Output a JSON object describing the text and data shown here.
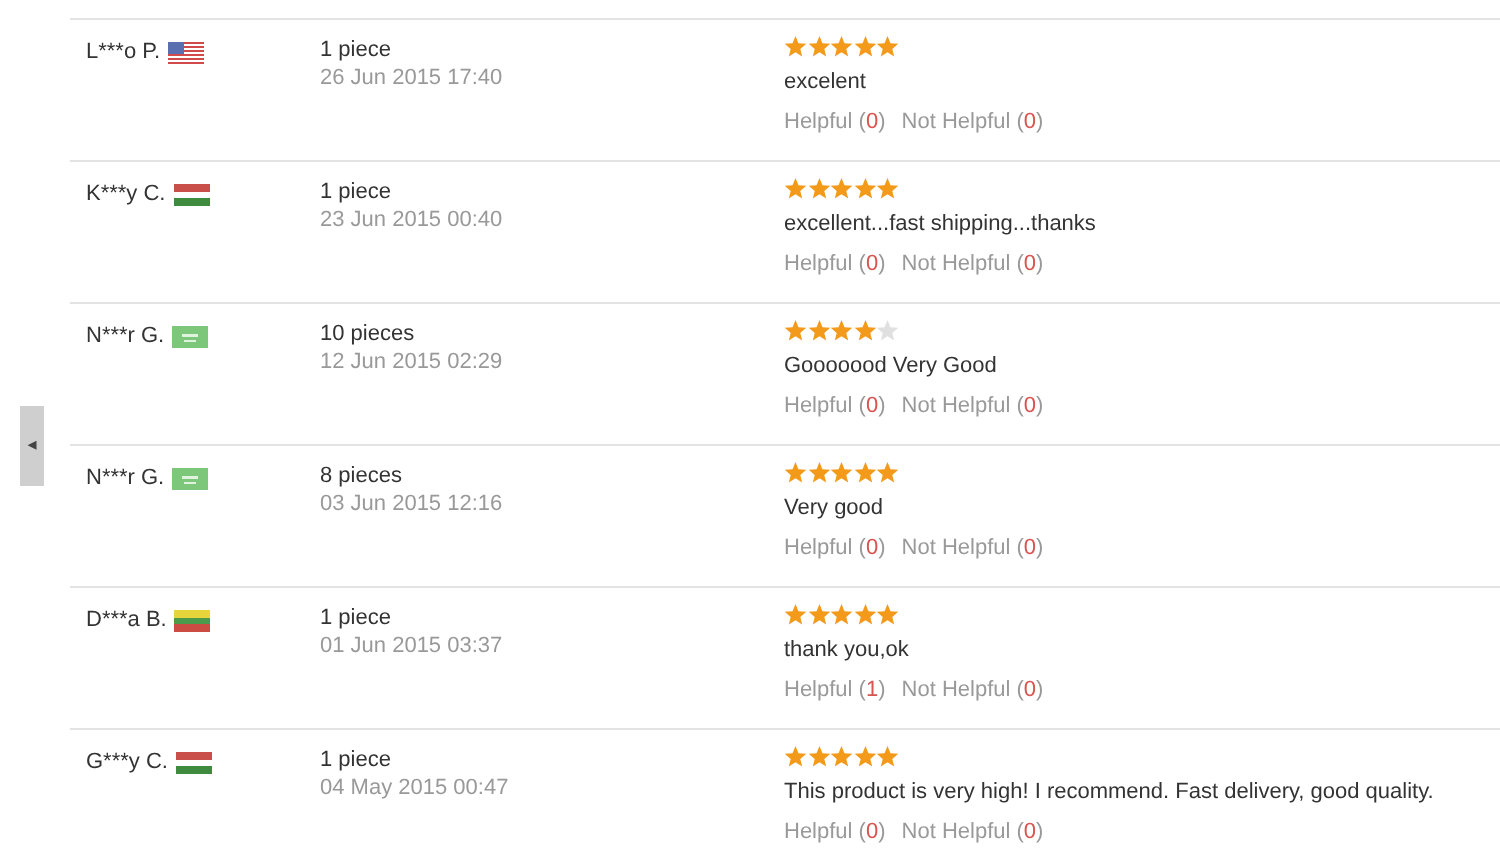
{
  "side_tab": {
    "icon": "◂"
  },
  "reviews": [
    {
      "reviewer": "L***o P.",
      "flag": {
        "kind": "us"
      },
      "quantity": "1 piece",
      "date": "26 Jun 2015 17:40",
      "stars": 5,
      "text": "excelent",
      "votes": [
        {
          "prefix": "Helpful (",
          "count": "0",
          "suffix": ")"
        },
        {
          "prefix": "Not Helpful (",
          "count": "0",
          "suffix": ")"
        }
      ]
    },
    {
      "reviewer": "K***y C.",
      "flag": {
        "kind": "hu"
      },
      "quantity": "1 piece",
      "date": "23 Jun 2015 00:40",
      "stars": 5,
      "text": "excellent...fast shipping...thanks",
      "votes": [
        {
          "prefix": "Helpful (",
          "count": "0",
          "suffix": ")"
        },
        {
          "prefix": "Not Helpful (",
          "count": "0",
          "suffix": ")"
        }
      ]
    },
    {
      "reviewer": "N***r G.",
      "flag": {
        "kind": "sa"
      },
      "quantity": "10 pieces",
      "date": "12 Jun 2015 02:29",
      "stars": 4,
      "text": "Gooooood Very Good",
      "votes": [
        {
          "prefix": "Helpful (",
          "count": "0",
          "suffix": ")"
        },
        {
          "prefix": "Not Helpful (",
          "count": "0",
          "suffix": ")"
        }
      ]
    },
    {
      "reviewer": "N***r G.",
      "flag": {
        "kind": "sa"
      },
      "quantity": "8 pieces",
      "date": "03 Jun 2015 12:16",
      "stars": 5,
      "text": "Very good",
      "votes": [
        {
          "prefix": "Helpful (",
          "count": "0",
          "suffix": ")"
        },
        {
          "prefix": "Not Helpful (",
          "count": "0",
          "suffix": ")"
        }
      ]
    },
    {
      "reviewer": "D***a B.",
      "flag": {
        "kind": "lt"
      },
      "quantity": "1 piece",
      "date": "01 Jun 2015 03:37",
      "stars": 5,
      "text": "thank you,ok",
      "votes": [
        {
          "prefix": "Helpful (",
          "count": "1",
          "suffix": ")"
        },
        {
          "prefix": "Not Helpful (",
          "count": "0",
          "suffix": ")"
        }
      ]
    },
    {
      "reviewer": "G***y C.",
      "flag": {
        "kind": "hu"
      },
      "quantity": "1 piece",
      "date": "04 May 2015 00:47",
      "stars": 5,
      "text": "This product is very high! I recommend. Fast delivery, good quality.",
      "votes": [
        {
          "prefix": "Helpful (",
          "count": "0",
          "suffix": ")"
        },
        {
          "prefix": "Not Helpful (",
          "count": "0",
          "suffix": ")"
        }
      ]
    }
  ]
}
